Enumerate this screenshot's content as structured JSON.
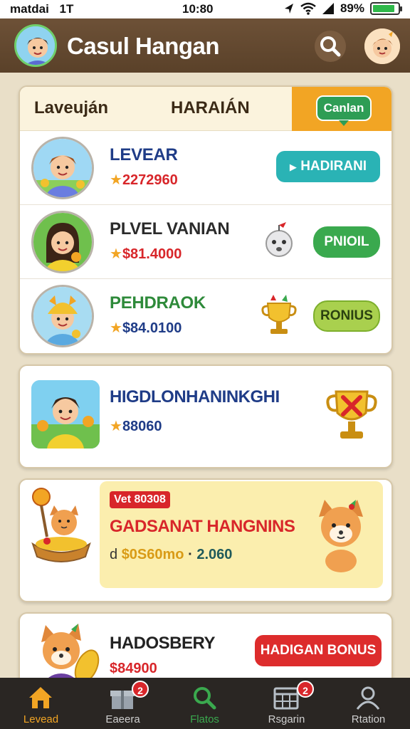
{
  "status": {
    "left": "matdai",
    "signal_text": "1T",
    "time": "10:80",
    "battery": "89%",
    "battery_level": 0.89
  },
  "app": {
    "title": "Casul Hangan"
  },
  "tabs": {
    "a": "Laveuján",
    "b": "HARAIÁN",
    "action": "Canlan"
  },
  "rows": [
    {
      "name": "LEVEAR",
      "amount": "2272960",
      "button": "HADIRANI"
    },
    {
      "name": "PLVEL VANIAN",
      "amount": "$81.4000",
      "button": "PNIOIL"
    },
    {
      "name": "PEHDRAOK",
      "amount": "$84.0100",
      "button": "RONIUS"
    }
  ],
  "card2": {
    "name": "HIGDLONHANINKGHI",
    "amount": "88060"
  },
  "promo": {
    "badge": "Vet 80308",
    "title": "GADSANAT HANGNINS",
    "prefix": "d",
    "amount": "$0S60mo",
    "sep": "·",
    "count": "2.060"
  },
  "card4": {
    "name": "HADOSBERY",
    "amount": "$84900",
    "button": "HADIGAN BONUS"
  },
  "nav": [
    {
      "label": "Levead",
      "color": "#f2a524"
    },
    {
      "label": "Eaeera",
      "badge": "2"
    },
    {
      "label": "Flatos",
      "color": "#3aa94e"
    },
    {
      "label": "Rsgarin",
      "badge": "2"
    },
    {
      "label": "Rtation"
    }
  ],
  "colors": {
    "header": "#5a4129",
    "accent_orange": "#f2a524",
    "teal": "#2ab3b5",
    "green": "#3aa94e",
    "red": "#d8262a"
  }
}
